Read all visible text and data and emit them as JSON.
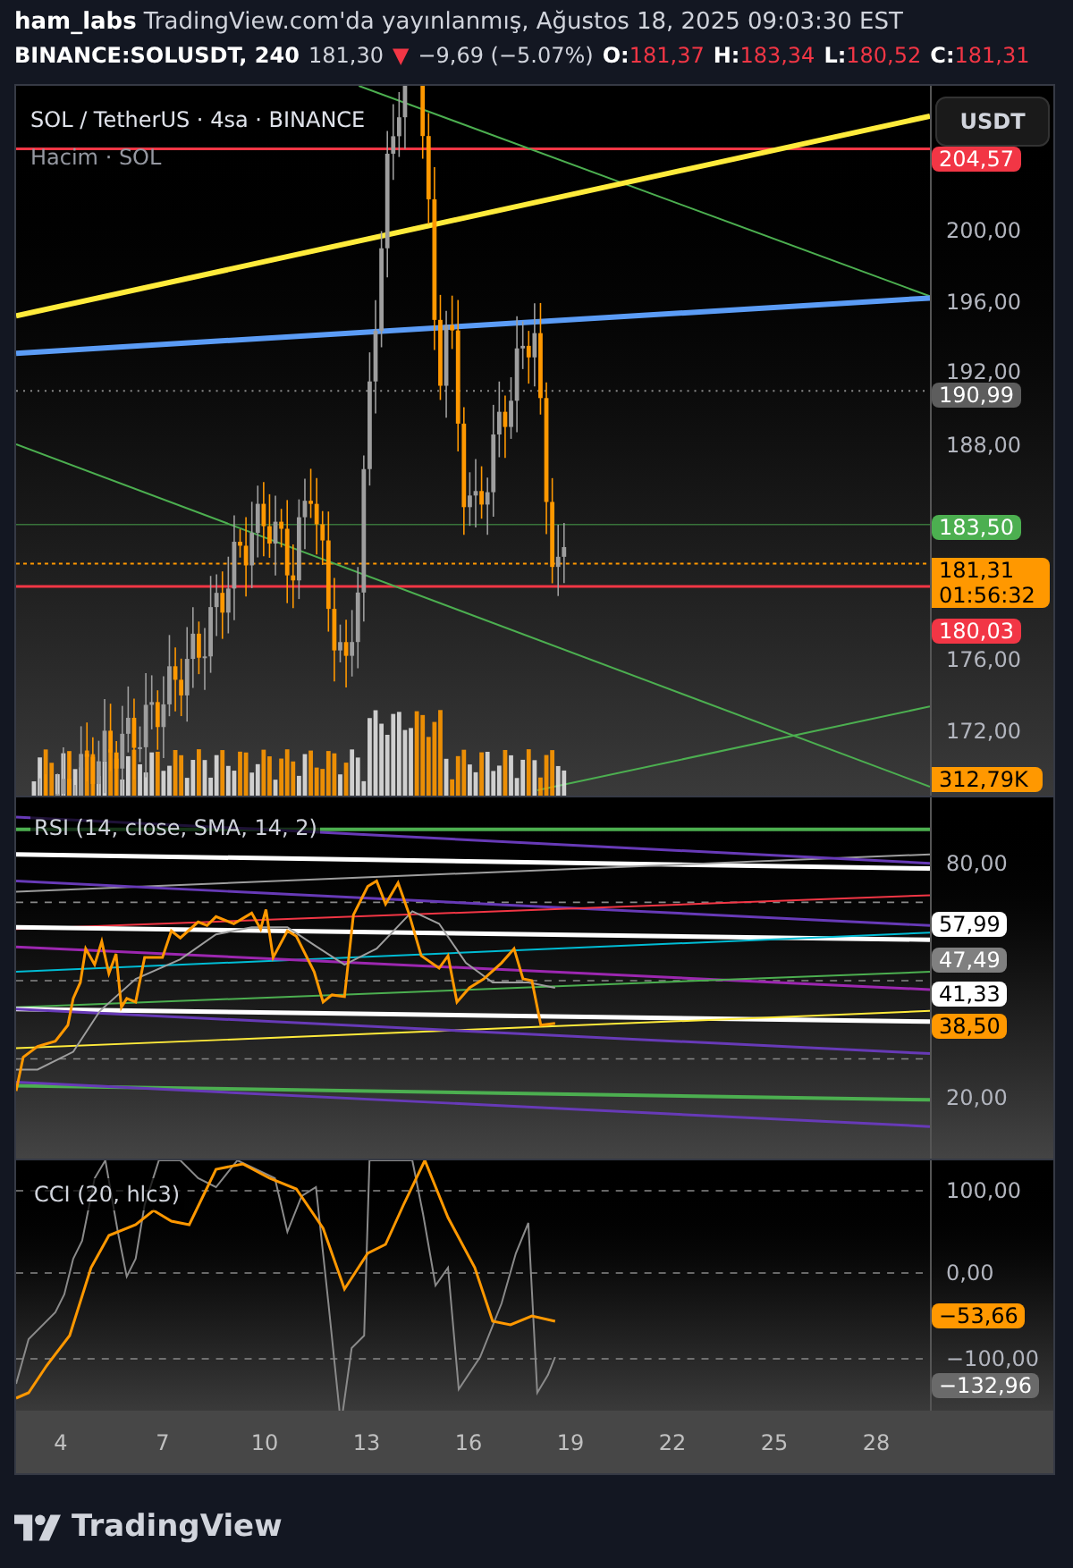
{
  "header": {
    "author": "ham_labs",
    "published": "TradingView.com'da yayınlanmış, Ağustos 18, 2025 09:03:30 EST"
  },
  "quote": {
    "symbol": "BINANCE:SOLUSDT, 240",
    "last": "181,30",
    "change_arrow": "▼",
    "change": "−9,69 (−5.07%)",
    "ohlc": [
      {
        "label": "O:",
        "value": "181,37"
      },
      {
        "label": "H:",
        "value": "183,34"
      },
      {
        "label": "L:",
        "value": "180,52"
      },
      {
        "label": "C:",
        "value": "181,31"
      }
    ]
  },
  "price_pane": {
    "title": "SOL / TetherUS · 4sa · BINANCE",
    "volume_label": "Hacim · SOL",
    "currency_button": "USDT",
    "axis_ticks": [
      "200,00",
      "196,00",
      "192,00",
      "188,00",
      "176,00",
      "172,00"
    ],
    "markers": [
      {
        "kind": "line",
        "text": "204,57",
        "color": "#f23645"
      },
      {
        "kind": "line",
        "text": "190,99",
        "color": "#5d5d5d"
      },
      {
        "kind": "line",
        "text": "183,50",
        "color": "#4caf50"
      },
      {
        "kind": "last",
        "text": "181,31",
        "countdown": "01:56:32",
        "color": "#ff9800"
      },
      {
        "kind": "line",
        "text": "180,03",
        "color": "#f23645"
      },
      {
        "kind": "volume",
        "text": "312,79K",
        "color": "#ff9800"
      }
    ]
  },
  "rsi_pane": {
    "title": "RSI (14, close, SMA, 14, 2)",
    "axis_ticks": [
      "80,00",
      "20,00"
    ],
    "markers": [
      {
        "text": "57,99",
        "color": "#ffffff"
      },
      {
        "text": "47,49",
        "color": "#808080"
      },
      {
        "text": "41,33",
        "color": "#ffffff"
      },
      {
        "text": "38,50",
        "color": "#ff9800"
      }
    ]
  },
  "cci_pane": {
    "title": "CCI (20, hlc3)",
    "axis_ticks": [
      "100,00",
      "0,00",
      "−100,00"
    ],
    "markers": [
      {
        "text": "−53,66",
        "color": "#ff9800"
      },
      {
        "text": "−132,96",
        "color": "#6a6a6a"
      }
    ]
  },
  "time_axis": [
    "4",
    "7",
    "10",
    "13",
    "16",
    "19",
    "22",
    "25",
    "28"
  ],
  "footer": {
    "brand": "TradingView"
  }
}
